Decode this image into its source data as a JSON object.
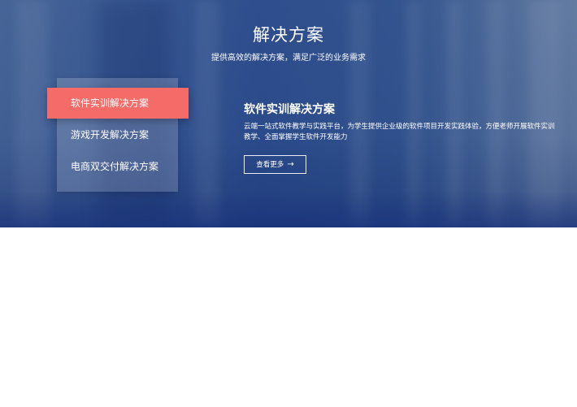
{
  "hero": {
    "title": "解决方案",
    "subtitle": "提供高效的解决方案，满足广泛的业务需求"
  },
  "menu": {
    "items": [
      {
        "label": "软件实训解决方案",
        "active": true
      },
      {
        "label": "游戏开发解决方案",
        "active": false
      },
      {
        "label": "电商双交付解决方案",
        "active": false
      }
    ]
  },
  "content": {
    "title": "软件实训解决方案",
    "description": "云端一站式软件教学与实践平台，为学生提供企业级的软件项目开发实践体验，方便老师开展软件实训教学、全面掌握学生软件开发能力",
    "more_label": "查看更多",
    "more_icon": "arrow-right-icon"
  },
  "colors": {
    "accent": "#f46b67",
    "hero_blue": "#2f4f8d"
  }
}
